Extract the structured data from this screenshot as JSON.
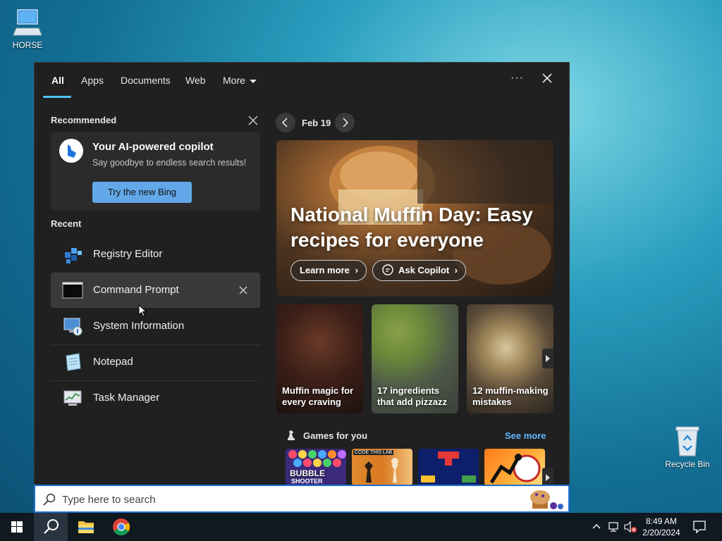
{
  "desktop": {
    "icons": [
      {
        "label": "HORSE"
      },
      {
        "label": "Recycle Bin"
      }
    ]
  },
  "tabs": [
    {
      "label": "All"
    },
    {
      "label": "Apps"
    },
    {
      "label": "Documents"
    },
    {
      "label": "Web"
    },
    {
      "label": "More"
    }
  ],
  "recommended": {
    "title": "Recommended",
    "card_title": "Your AI-powered copilot",
    "card_subtitle": "Say goodbye to endless search results!",
    "card_button": "Try the new Bing"
  },
  "recent": {
    "title": "Recent",
    "items": [
      {
        "label": "Registry Editor"
      },
      {
        "label": "Command Prompt"
      },
      {
        "label": "System Information"
      },
      {
        "label": "Notepad"
      },
      {
        "label": "Task Manager"
      }
    ]
  },
  "news": {
    "date": "Feb 19",
    "hero_title": "National Muffin Day: Easy recipes for everyone",
    "learn_more": "Learn more",
    "ask_copilot": "Ask Copilot",
    "tiles": [
      {
        "caption": "Muffin magic for every craving"
      },
      {
        "caption": "17 ingredients that add pizzazz"
      },
      {
        "caption": "12 muffin-making mistakes"
      }
    ]
  },
  "games": {
    "title": "Games for you",
    "see_more": "See more",
    "thumb_text": [
      "BUBBLE",
      "SHOOTER",
      "CODE THIS LAB"
    ]
  },
  "search": {
    "placeholder": "Type here to search"
  },
  "taskbar": {
    "time": "8:49 AM",
    "date": "2/20/2024"
  },
  "colors": {
    "accent": "#4cc2ff",
    "panel_bg": "#202020",
    "link": "#60b6ff",
    "bing_button": "#62a8e8"
  }
}
